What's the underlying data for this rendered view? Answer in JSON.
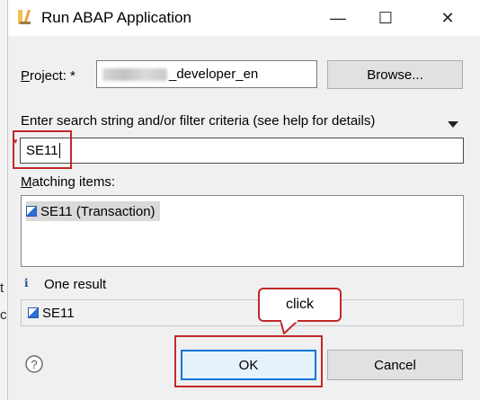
{
  "window": {
    "title": "Run ABAP Application",
    "minimize_symbol": "—",
    "maximize_symbol": "☐",
    "close_symbol": "✕"
  },
  "background_window": {
    "left_edge_letters": [
      "t",
      "c"
    ]
  },
  "project": {
    "label_underlined": "P",
    "label_rest": "roject: *",
    "value_suffix": "_developer_en",
    "browse_label": "Browse..."
  },
  "search": {
    "label": "Enter search string and/or filter criteria (see help for details)",
    "value": "SE11"
  },
  "matching": {
    "label_underlined": "M",
    "label_rest": "atching items:",
    "items": [
      {
        "icon": "transaction-icon",
        "label": "SE11 (Transaction)"
      }
    ]
  },
  "status": {
    "icon": "info-icon",
    "text": "One result",
    "selected_item": "SE11"
  },
  "buttons": {
    "help_symbol": "?",
    "ok_label": "OK",
    "cancel_label": "Cancel"
  },
  "annotation": {
    "callout_text": "click"
  },
  "colors": {
    "highlight_red": "#c0282a",
    "selection_bg": "#d9d9d9",
    "ok_border_blue": "#0078d7"
  }
}
